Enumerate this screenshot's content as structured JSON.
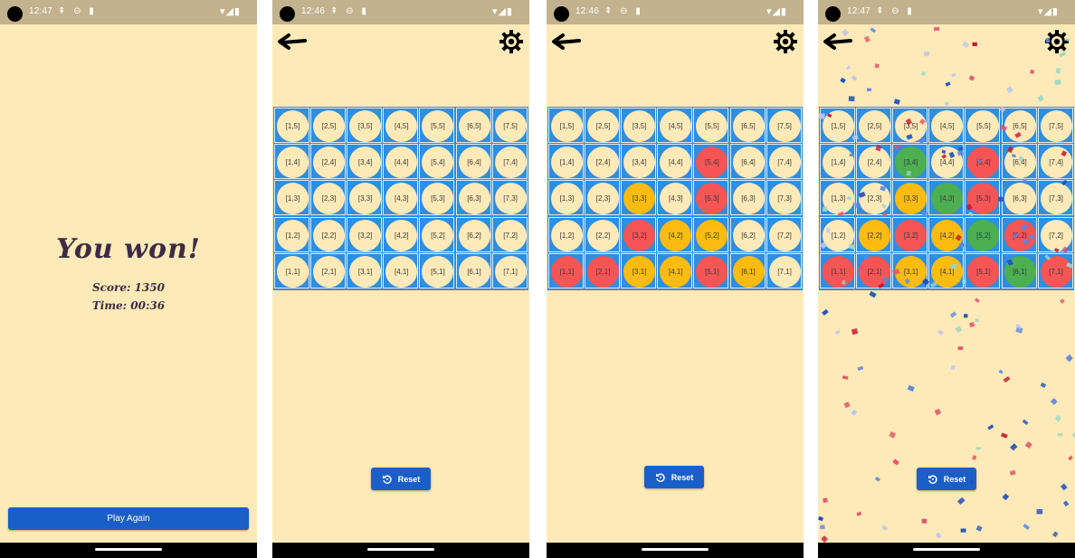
{
  "screens": [
    {
      "time": "12:47",
      "win": {
        "title": "You won!",
        "score": "Score: 1350",
        "time": "Time: 00:36"
      },
      "play_again_label": "Play Again"
    },
    {
      "time": "12:46",
      "reset_label": "Reset",
      "colors": [
        [
          "",
          "",
          "",
          "",
          "",
          "",
          ""
        ],
        [
          "",
          "",
          "",
          "",
          "",
          "",
          ""
        ],
        [
          "",
          "",
          "",
          "",
          "",
          "",
          ""
        ],
        [
          "",
          "",
          "",
          "",
          "",
          "",
          ""
        ],
        [
          "",
          "",
          "",
          "",
          "",
          "",
          ""
        ]
      ]
    },
    {
      "time": "12:46",
      "reset_label": "Reset",
      "colors": [
        [
          "",
          "",
          "",
          "",
          "",
          "",
          ""
        ],
        [
          "",
          "",
          "",
          "",
          "red",
          "",
          ""
        ],
        [
          "",
          "",
          "yellow",
          "",
          "red",
          "",
          ""
        ],
        [
          "",
          "",
          "red",
          "yellow",
          "yellow",
          "",
          ""
        ],
        [
          "red",
          "red",
          "yellow",
          "yellow",
          "red",
          "yellow",
          ""
        ]
      ]
    },
    {
      "time": "12:47",
      "reset_label": "Reset",
      "colors": [
        [
          "",
          "",
          "",
          "",
          "",
          "",
          ""
        ],
        [
          "",
          "",
          "green",
          "",
          "red",
          "",
          ""
        ],
        [
          "",
          "",
          "yellow",
          "green",
          "red",
          "",
          ""
        ],
        [
          "",
          "yellow",
          "red",
          "yellow",
          "green",
          "red",
          ""
        ],
        [
          "red",
          "red",
          "yellow",
          "yellow",
          "red",
          "green",
          "red"
        ]
      ],
      "confetti": true
    }
  ],
  "cell_labels": [
    [
      "[1,5]",
      "[2,5]",
      "[3,5]",
      "[4,5]",
      "[5,5]",
      "[6,5]",
      "[7,5]"
    ],
    [
      "[1,4]",
      "[2,4]",
      "[3,4]",
      "[4,4]",
      "[5,4]",
      "[6,4]",
      "[7,4]"
    ],
    [
      "[1,3]",
      "[2,3]",
      "[3,3]",
      "[4,3]",
      "[5,3]",
      "[6,3]",
      "[7,3]"
    ],
    [
      "[1,2]",
      "[2,2]",
      "[3,2]",
      "[4,2]",
      "[5,2]",
      "[6,2]",
      "[7,2]"
    ],
    [
      "[1,1]",
      "[2,1]",
      "[3,1]",
      "[4,1]",
      "[5,1]",
      "[6,1]",
      "[7,1]"
    ]
  ],
  "icons": {
    "back": "back-arrow-icon",
    "settings": "gear-icon",
    "reset": "reset-icon"
  },
  "theme": {
    "background": "#feeab8",
    "board": "#2e8ee0",
    "button": "#1a5fc8",
    "red": "#f55555",
    "yellow": "#fbbb10",
    "green": "#4caf50",
    "status_bar": "#c2b28d"
  }
}
